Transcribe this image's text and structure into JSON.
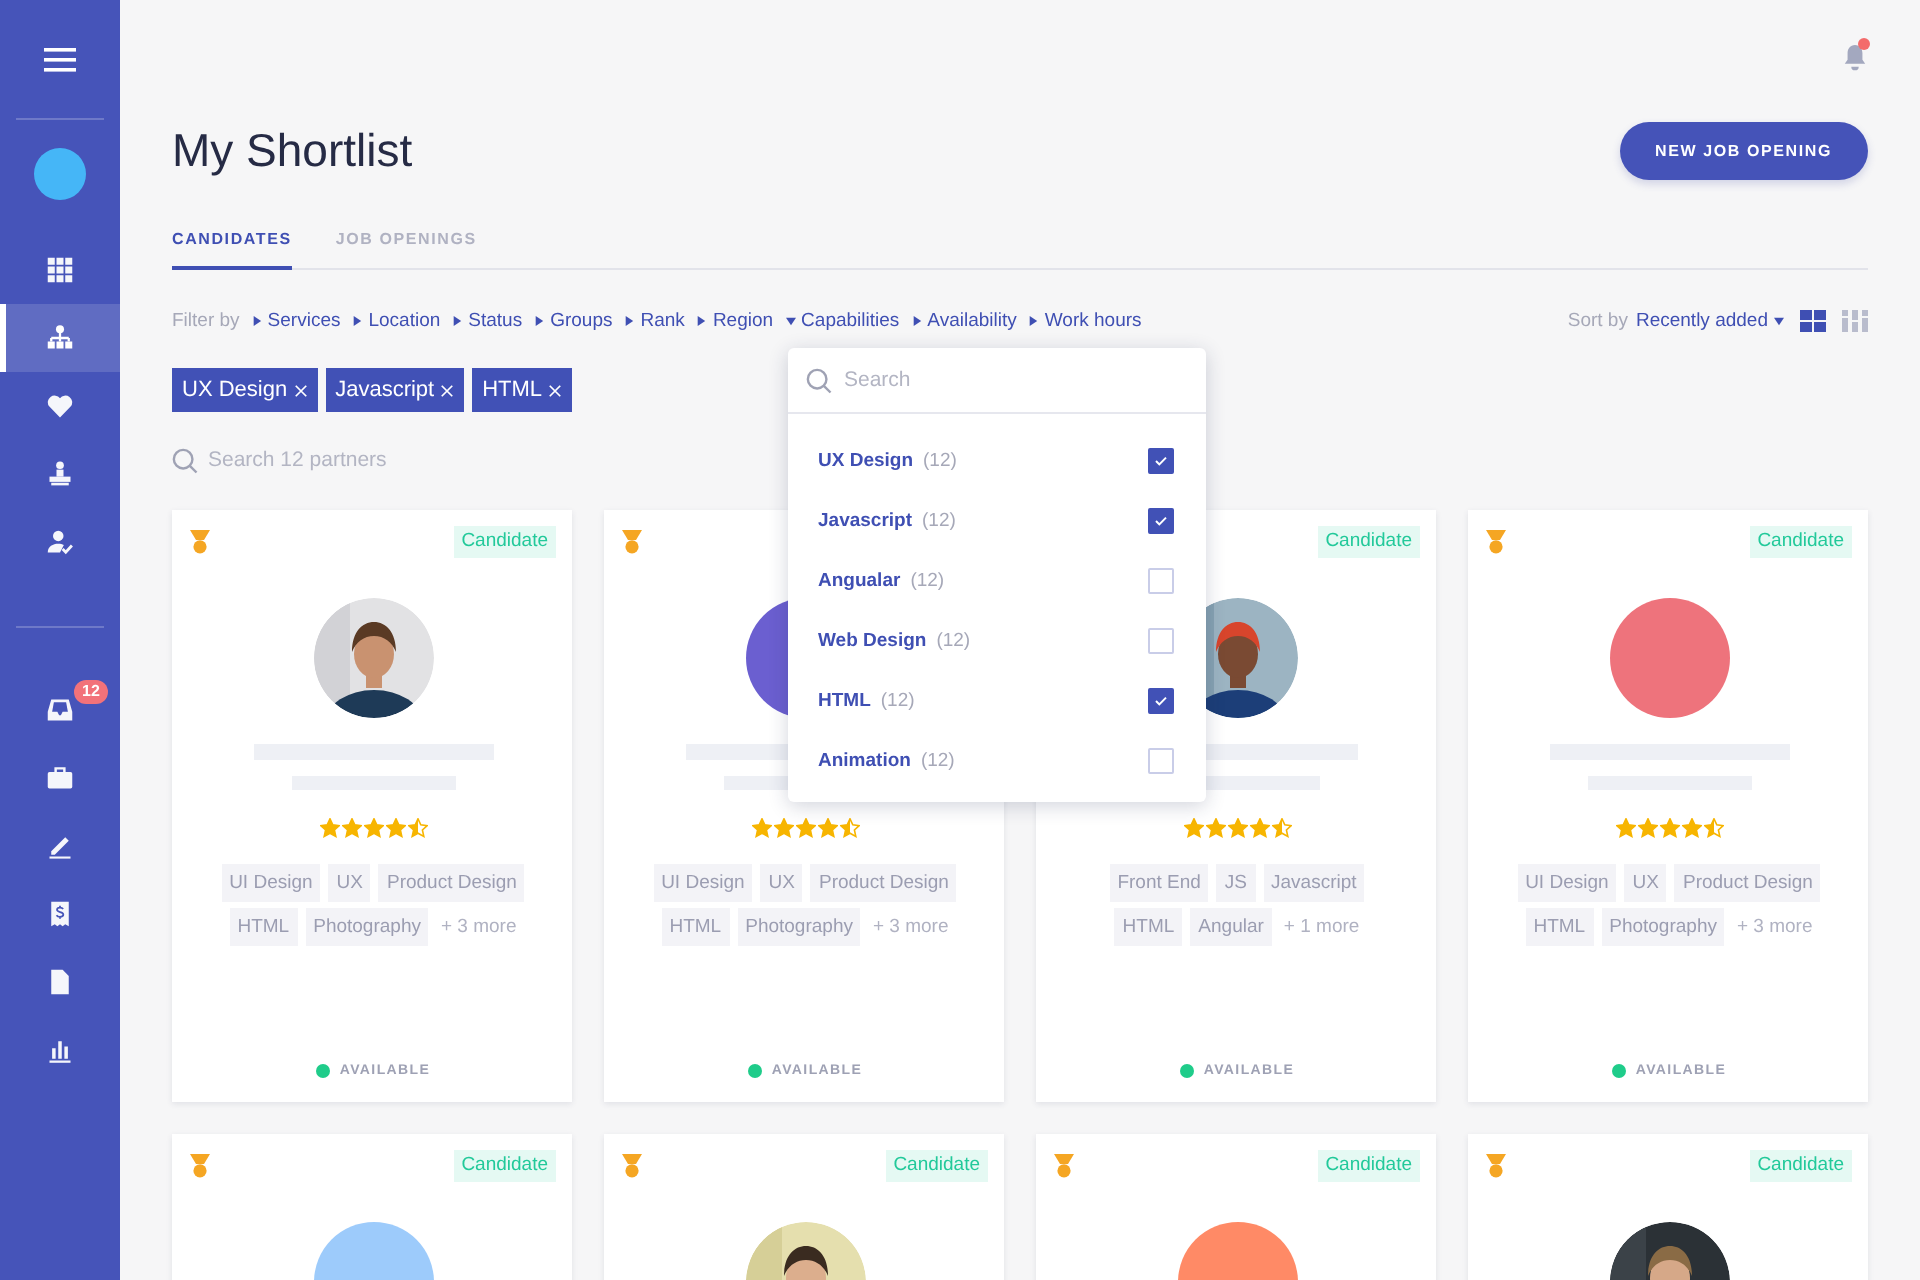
{
  "sidebar": {
    "primary_items": [
      {
        "kind": "grid",
        "selected": false
      },
      {
        "kind": "network",
        "selected": true
      },
      {
        "kind": "heart",
        "selected": false
      },
      {
        "kind": "podium",
        "selected": false
      },
      {
        "kind": "user-check",
        "selected": false
      }
    ],
    "secondary_items": [
      {
        "kind": "inbox",
        "selected": false,
        "badge": "12"
      },
      {
        "kind": "briefcase",
        "selected": false
      },
      {
        "kind": "pencil",
        "selected": false
      },
      {
        "kind": "invoice",
        "selected": false
      },
      {
        "kind": "document",
        "selected": false
      },
      {
        "kind": "chart",
        "selected": false
      }
    ]
  },
  "header": {
    "notifications": {
      "unread": true
    },
    "title": "My Shortlist",
    "primary_button": "NEW JOB OPENING"
  },
  "tabs": [
    {
      "label": "CANDIDATES",
      "selected": true
    },
    {
      "label": "JOB OPENINGS",
      "selected": false
    }
  ],
  "filter_bar": {
    "label": "Filter by",
    "filters": [
      {
        "label": "Services",
        "expanded": false
      },
      {
        "label": "Location",
        "expanded": false
      },
      {
        "label": "Status",
        "expanded": false
      },
      {
        "label": "Groups",
        "expanded": false
      },
      {
        "label": "Rank",
        "expanded": false
      },
      {
        "label": "Region",
        "expanded": false
      },
      {
        "label": "Capabilities",
        "expanded": true
      },
      {
        "label": "Availability",
        "expanded": false
      },
      {
        "label": "Work hours",
        "expanded": false
      }
    ],
    "sort": {
      "label": "Sort by",
      "value": "Recently added"
    },
    "view_modes": [
      {
        "kind": "large-grid",
        "selected": true
      },
      {
        "kind": "small-grid",
        "selected": false
      }
    ]
  },
  "active_filters": [
    "UX Design",
    "Javascript",
    "HTML"
  ],
  "search": {
    "placeholder": "Search 12 partners"
  },
  "capabilities_dropdown": {
    "search_placeholder": "Search",
    "options": [
      {
        "label": "UX Design",
        "count": "(12)",
        "checked": true
      },
      {
        "label": "Javascript",
        "count": "(12)",
        "checked": true
      },
      {
        "label": "Angualar",
        "count": "(12)",
        "checked": false
      },
      {
        "label": "Web Design",
        "count": "(12)",
        "checked": false
      },
      {
        "label": "HTML",
        "count": "(12)",
        "checked": true
      },
      {
        "label": "Animation",
        "count": "(12)",
        "checked": false
      }
    ]
  },
  "cards": [
    {
      "medal": true,
      "badge": "Candidate",
      "avatar": {
        "kind": "picture"
      },
      "stars": 4.5,
      "tags": [
        "UI Design",
        "UX",
        "Product Design",
        "HTML",
        "Photography"
      ],
      "more": "+ 3 more",
      "status": {
        "label": "AVAILABLE",
        "color": "#1fcc8a"
      }
    },
    {
      "medal": true,
      "avatar": {
        "kind": "circle",
        "color": "#6b5fd0"
      },
      "stars": 4.5,
      "tags": [
        "UI Design",
        "UX",
        "Product Design",
        "HTML",
        "Photography"
      ],
      "more": "+ 3 more",
      "status": {
        "label": "AVAILABLE",
        "color": "#1fcc8a"
      }
    },
    {
      "badge": "Candidate",
      "avatar": {
        "kind": "picture"
      },
      "stars": 4.5,
      "tags": [
        "Front End",
        "JS",
        "Javascript",
        "HTML",
        "Angular"
      ],
      "more": "+ 1 more",
      "status": {
        "label": "AVAILABLE",
        "color": "#1fcc8a"
      }
    },
    {
      "medal": true,
      "badge": "Candidate",
      "avatar": {
        "kind": "circle",
        "color": "#ee737c"
      },
      "stars": 4.5,
      "tags": [
        "UI Design",
        "UX",
        "Product Design",
        "HTML",
        "Photography"
      ],
      "more": "+ 3 more",
      "status": {
        "label": "AVAILABLE",
        "color": "#1fcc8a"
      }
    },
    {
      "medal": true,
      "badge": "Candidate",
      "avatar": {
        "kind": "circle",
        "color": "#9dcbfb"
      }
    },
    {
      "medal": true,
      "badge": "Candidate",
      "avatar": {
        "kind": "picture"
      }
    },
    {
      "medal": true,
      "badge": "Candidate",
      "avatar": {
        "kind": "circle",
        "color": "#ff8a66"
      }
    },
    {
      "medal": true,
      "badge": "Candidate",
      "avatar": {
        "kind": "picture"
      }
    }
  ]
}
